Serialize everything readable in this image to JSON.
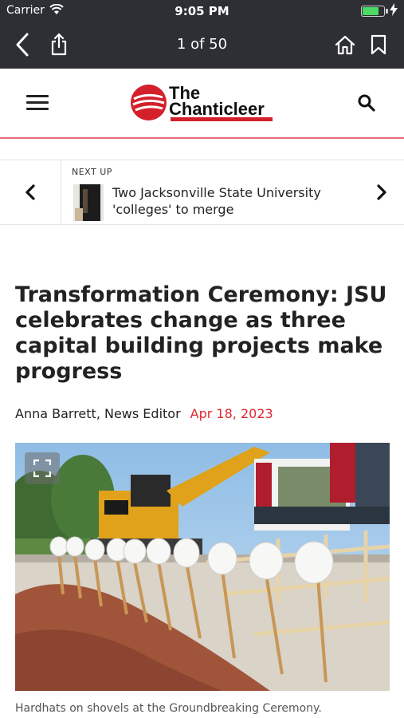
{
  "status": {
    "carrier": "Carrier",
    "time": "9:05 PM"
  },
  "nav": {
    "page_count": "1 of 50"
  },
  "site": {
    "logo_word1": "The",
    "logo_word2": "Chanticleer"
  },
  "next_up": {
    "label": "NEXT UP",
    "title": "Two Jacksonville State University 'colleges' to merge"
  },
  "article": {
    "headline": "Transformation Ceremony: JSU celebrates change as three capital building projects make progress",
    "author": "Anna Barrett, News Editor",
    "date": "Apr 18, 2023",
    "caption": "Hardhats on shovels at the Groundbreaking Ceremony."
  },
  "colors": {
    "top_bar": "#2d2f35",
    "accent_red": "#e0272f",
    "divider_pink": "#e46c78"
  }
}
